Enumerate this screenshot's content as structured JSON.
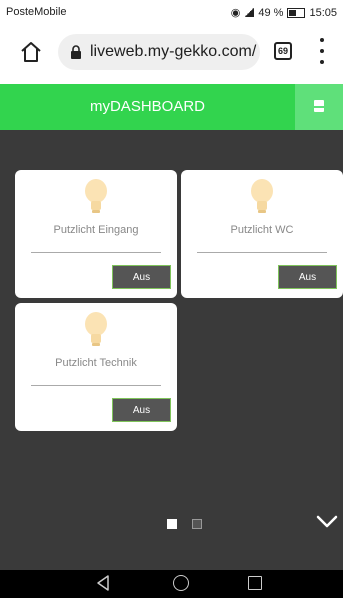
{
  "status_bar": {
    "carrier": "PosteMobile",
    "battery_percent": "49 %",
    "time": "15:05"
  },
  "browser": {
    "url": "liveweb.my-gekko.com/",
    "tab_count": "69"
  },
  "app": {
    "title": "myDASHBOARD"
  },
  "cards": [
    {
      "label": "Putzlicht Eingang",
      "button": "Aus"
    },
    {
      "label": "Putzlicht WC",
      "button": "Aus"
    },
    {
      "label": "Putzlicht Technik",
      "button": "Aus"
    }
  ],
  "pager": {
    "current_page": 1,
    "page_count": 2
  },
  "icons": {
    "home": "home-icon",
    "lock": "lock-icon",
    "menu": "more-vert-icon",
    "bulb": "light-bulb-icon",
    "chevron": "chevron-down-icon",
    "header_button": "door-icon"
  },
  "colors": {
    "header_green": "#32d44e",
    "button_border": "#7fc45a",
    "background": "#3a3a3a"
  }
}
